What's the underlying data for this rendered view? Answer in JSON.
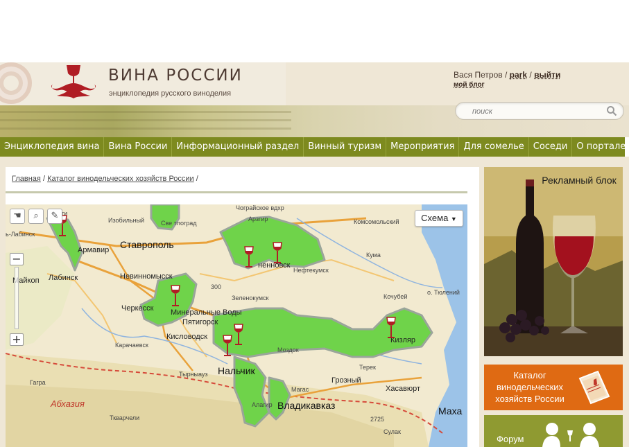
{
  "header": {
    "site_title": "ВИНА РОССИИ",
    "site_subtitle": "энциклопедия русского виноделия",
    "user_name": "Вася Петров",
    "separator": "/",
    "username": "park",
    "logout": "выйти",
    "my_blog": "мой блог",
    "search_placeholder": "поиск"
  },
  "nav": {
    "items": [
      {
        "label": "Энциклопедия вина"
      },
      {
        "label": "Вина России"
      },
      {
        "label": "Информационный раздел"
      },
      {
        "label": "Винный туризм"
      },
      {
        "label": "Мероприятия"
      },
      {
        "label": "Для сомелье"
      },
      {
        "label": "Соседи"
      },
      {
        "label": "О портале"
      }
    ]
  },
  "breadcrumb": {
    "home": "Главная",
    "catalog": "Каталог винодельческих хозяйств России",
    "sep": "/"
  },
  "map": {
    "scheme_button": "Схема",
    "labels": {
      "stavropol": "Ставрополь",
      "armavir": "Армавир",
      "labinsk_left": "ь-Лабинск",
      "izobilny": "Изобильный",
      "svetlograd": "Све   тлоград",
      "ti": "ти",
      "nevinnomyssk": "Невинномысск",
      "labinsk": "Лабинск",
      "maykop": "Майкоп",
      "cherkessk": "Черкесск",
      "mineralnye": "Минеральные Воды",
      "pyatigorsk": "Пятигорск",
      "kislovodsk": "Кисловодск",
      "karachaevsk": "Карачаевск",
      "tyrnyauz": "Тырныауз",
      "nalchik": "Нальчик",
      "zelenokumsk": "Зеленокумск",
      "arzgir": "Арзгир",
      "komsomolsky": "Комсомольский",
      "neftekumsk": "Нефтекумск",
      "budennovsk": "ненновск",
      "kochubey": "Кочубей",
      "kizlyar": "Кизляр",
      "grozny": "Грозный",
      "khasavyurt": "Хасавюрт",
      "magas": "Магас",
      "vladikavkaz": "Владикавказ",
      "alagir": "Алагир",
      "makhachkala": "Маха",
      "abkhazia": "Абхазия",
      "gagra": "Гагра",
      "tkvarcheli": "Ткварчели",
      "kuma": "Кума",
      "terek": "Терек",
      "sulak": "Сулак",
      "uyutniy": "о. Тюлений",
      "chograi": "Чограйское вдхр",
      "mozdok": "Моздок",
      "sarp": "Кума",
      "h300": "300",
      "h2725": "2725"
    }
  },
  "sidebar": {
    "ad_text": "Рекламный блок",
    "catalog_text": "Каталог винодельческих хозяйств России",
    "forum_text": "Форум"
  },
  "colors": {
    "nav_bg": "#7d8a1f",
    "catalog_bg": "#df6a13",
    "forum_bg": "#8f9a31",
    "region_green": "#6fd34a",
    "header_bg": "#efe7d6"
  }
}
